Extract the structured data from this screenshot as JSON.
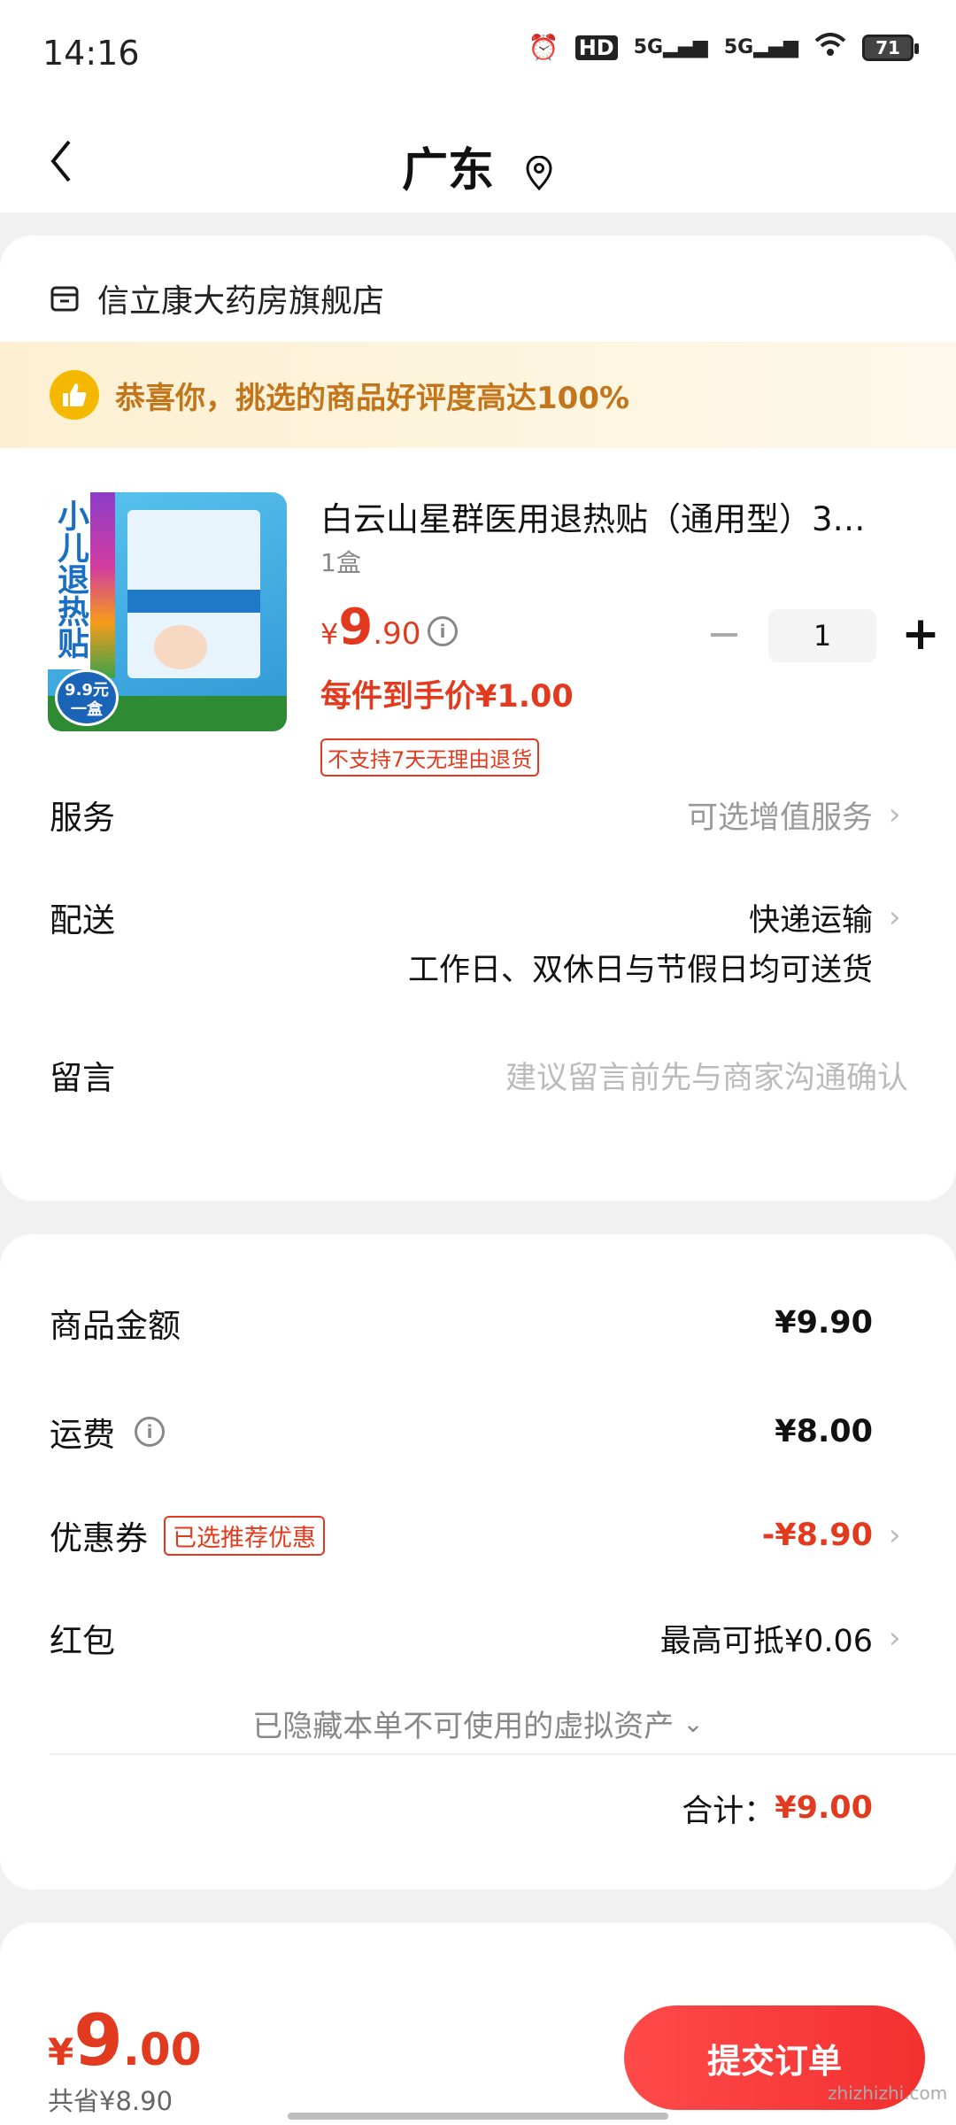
{
  "status_bar": {
    "time": "14:16",
    "battery": "71",
    "network1": "5G",
    "network2": "5G",
    "hd": "HD"
  },
  "nav": {
    "back_icon": "chevron-left-icon",
    "title": "广东",
    "location_icon": "location-pin-icon"
  },
  "store": {
    "icon": "store-icon",
    "name": "信立康大药房旗舰店"
  },
  "banner": {
    "icon": "thumbs-up-icon",
    "text": "恭喜你，挑选的商品好评度高达100%"
  },
  "product": {
    "title": "白云山星群医用退热贴（通用型）3…",
    "spec": "1盒",
    "price_currency": "¥",
    "price_int": "9",
    "price_dec": ".90",
    "quantity": "1",
    "final_price": "每件到手价¥1.00",
    "return_policy": "不支持7天无理由退货",
    "image_side_text": "小儿退热贴",
    "image_badge": "9.9元 一盒"
  },
  "rows": {
    "service_label": "服务",
    "service_value": "可选增值服务",
    "delivery_label": "配送",
    "delivery_value": "快递运输",
    "delivery_note": "工作日、双休日与节假日均可送货",
    "message_label": "留言",
    "message_placeholder": "建议留言前先与商家沟通确认"
  },
  "summary": {
    "goods_label": "商品金额",
    "goods_value": "¥9.90",
    "shipping_label": "运费",
    "shipping_value": "¥8.00",
    "coupon_label": "优惠券",
    "coupon_tag": "已选推荐优惠",
    "coupon_value": "-¥8.90",
    "redpack_label": "红包",
    "redpack_value": "最高可抵¥0.06",
    "hidden_assets": "已隐藏本单不可使用的虚拟资产",
    "total_label": "合计：",
    "total_value": "¥9.00"
  },
  "bottom": {
    "price_currency": "¥",
    "price_int": "9",
    "price_dec": ".00",
    "saved": "共省¥8.90",
    "submit": "提交订单"
  },
  "watermark": "zhizhizhi.com",
  "colors": {
    "accent_red": "#e23a1e",
    "banner_text": "#c2751a",
    "submit_bg": "#f23030"
  }
}
